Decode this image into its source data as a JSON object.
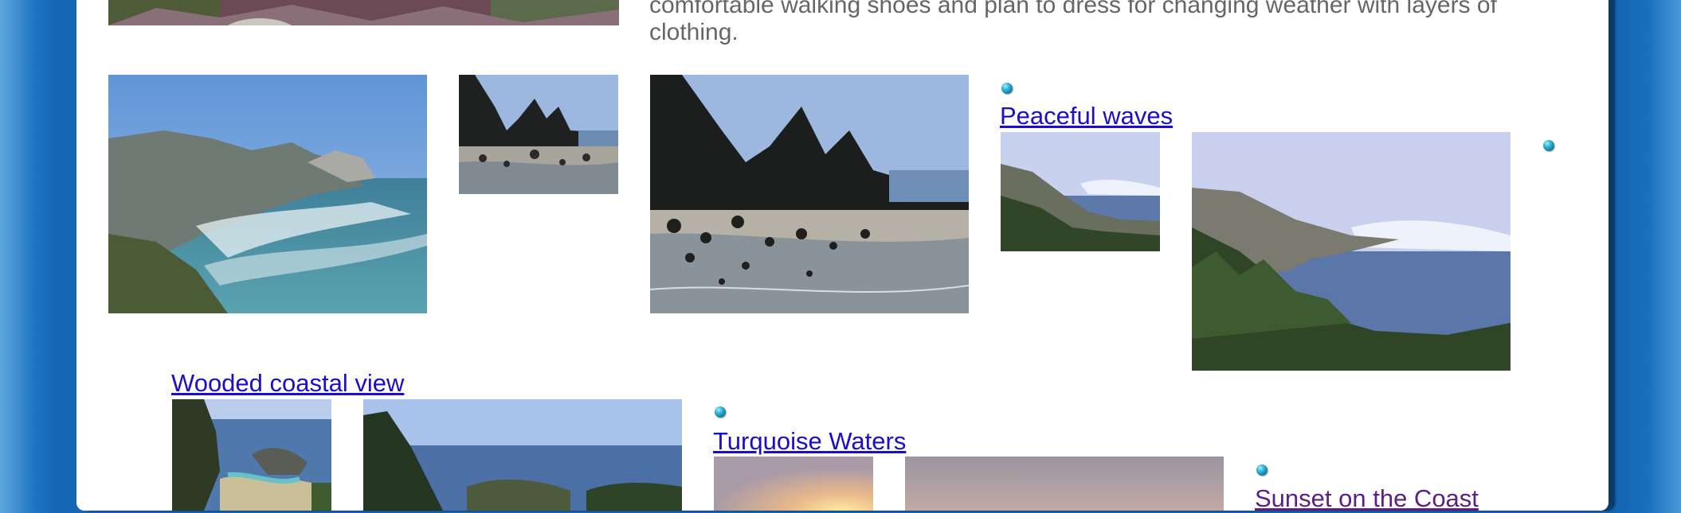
{
  "intro": {
    "text": "comfortable walking shoes and plan to dress for changing weather with layers of clothing."
  },
  "galleries": [
    {
      "link_label": "Peaceful waves"
    },
    {
      "link_label": "Wooded coastal view"
    },
    {
      "link_label": "Turquoise Waters"
    },
    {
      "link_label": "Sunset on the Coast"
    }
  ],
  "colors": {
    "background_blue": "#1467b5",
    "link_blue": "#1a0dcc",
    "link_visited": "#5b1f86",
    "body_text": "#666666"
  }
}
